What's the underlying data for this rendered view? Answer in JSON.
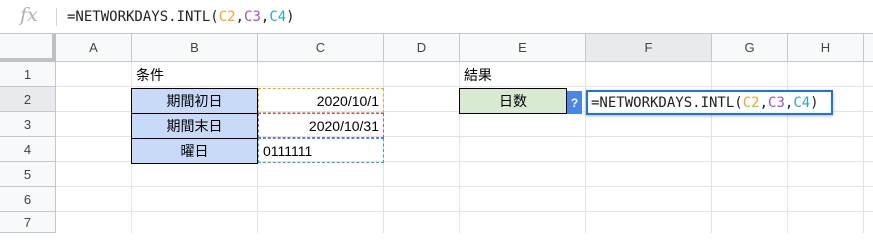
{
  "formula_bar": {
    "fx_label": "fx",
    "formula_prefix": "=NETWORKDAYS.INTL(",
    "ref1": "C2",
    "comma1": ",",
    "ref2": "C3",
    "comma2": ",",
    "ref3": "C4",
    "formula_suffix": ")"
  },
  "columns": [
    "A",
    "B",
    "C",
    "D",
    "E",
    "F",
    "G",
    "H"
  ],
  "rows": [
    "1",
    "2",
    "3",
    "4",
    "5",
    "6",
    "7"
  ],
  "cells": {
    "B1": "条件",
    "E1": "結果",
    "B2": "期間初日",
    "C2": "2020/10/1",
    "B3": "期間末日",
    "C3": "2020/10/31",
    "B4": "曜日",
    "C4": "0111111",
    "E2": "日数"
  },
  "editor": {
    "help_label": "?",
    "formula_prefix": "=NETWORKDAYS.INTL(",
    "ref1": "C2",
    "comma1": ",",
    "ref2": "C3",
    "comma2": ",",
    "ref3": "C4",
    "formula_suffix": ")"
  },
  "colors": {
    "ref1": "#f5a623",
    "ref2": "#9a57c9",
    "ref3": "#2aa9b8",
    "label_fill": "#c9daf8",
    "result_fill": "#d9ead3",
    "active_border": "#1a73e8"
  }
}
